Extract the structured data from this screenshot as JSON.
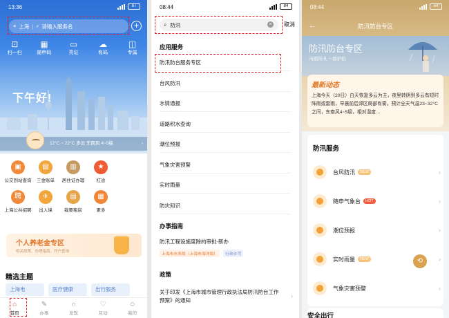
{
  "panel1": {
    "status": {
      "time": "13:36",
      "battery": "87"
    },
    "search": {
      "location": "上海",
      "placeholder": "请输入服务名"
    },
    "quick": [
      {
        "icon": "scan-icon",
        "glyph": "⊡",
        "label": "扫一扫"
      },
      {
        "icon": "qr-icon",
        "glyph": "▦",
        "label": "随申码"
      },
      {
        "icon": "card-icon",
        "glyph": "▭",
        "label": "亮证"
      },
      {
        "icon": "cloud-icon",
        "glyph": "☁",
        "label": "有码"
      },
      {
        "icon": "zone-icon",
        "glyph": "◫",
        "label": "专属"
      }
    ],
    "greeting": "下午好!",
    "weather": "12°C ~ 22°C  多云  东南风 4~5级",
    "services": [
      {
        "label": "公交到站查询",
        "color": "#f08a3a",
        "glyph": "▣"
      },
      {
        "label": "三金账单",
        "color": "#f3a63b",
        "glyph": "▤"
      },
      {
        "label": "居住证办理",
        "color": "#c79a62",
        "glyph": "▥"
      },
      {
        "label": "红途",
        "color": "#ee5b35",
        "glyph": "★"
      },
      {
        "label": "",
        "color": "",
        "glyph": ""
      },
      {
        "label": "上海公共招聘",
        "color": "#f08a3a",
        "glyph": "聘"
      },
      {
        "label": "出入境",
        "color": "#f3a63b",
        "glyph": "✈"
      },
      {
        "label": "我要租房",
        "color": "#e6a54a",
        "glyph": "▤"
      },
      {
        "label": "更多",
        "color": "#f0863a",
        "glyph": "▦"
      }
    ],
    "banner": {
      "title": "个人养老金专区",
      "subtitle": "相关政策、办理指南、开户查询"
    },
    "topics_title": "精选主题",
    "topics": [
      "上海电",
      "医疗健康",
      "出行服务"
    ],
    "tabs": [
      {
        "label": "首页",
        "icon": "home-icon",
        "glyph": "⌂",
        "active": true
      },
      {
        "label": "办事",
        "icon": "pen-icon",
        "glyph": "✎",
        "active": false
      },
      {
        "label": "发现",
        "icon": "discover-icon",
        "glyph": "∩",
        "active": false
      },
      {
        "label": "互动",
        "icon": "heart-icon",
        "glyph": "♡",
        "active": false
      },
      {
        "label": "我的",
        "icon": "user-icon",
        "glyph": "☺",
        "active": false
      }
    ]
  },
  "panel2": {
    "status": {
      "time": "08:44",
      "battery": "84"
    },
    "search": {
      "value": "防汛",
      "cancel": "取消"
    },
    "app_section": "应用服务",
    "app_items": [
      "防汛防台服务专区",
      "台风防汛",
      "水情通报",
      "道路积水查询",
      "潮位预报",
      "气象灾害预警",
      "实时雨量",
      "防灾知识"
    ],
    "guide_section": "办事指南",
    "guide": {
      "title": "防汛工程设施度除的审批-新办",
      "tag1": "上海市水务局（上海市海洋局）",
      "tag2": "行政许可"
    },
    "policy_section": "政策",
    "policy": "关于印发《上海市城市管理行政执法局防汛防台工作预案》的通知"
  },
  "panel3": {
    "status": {
      "time": "08:44",
      "battery": "84"
    },
    "title": "防汛防台专区",
    "hero_title": "防汛防台专区",
    "hero_sub": "汛期防汛 一路护航",
    "news_title_a": "最新",
    "news_title_b": "动态",
    "news_body": "上海今天（20日）白天恢复多云为主，夜里转阴到多云有短时阵雨或雷雨，早晨前后郊区局部有雾。预计全天气温23~32°C之间，东南风4~5级，相对湿度…",
    "services_title": "防汛服务",
    "services": [
      {
        "label": "台风防汛",
        "badge": "NEW",
        "badge_type": "new"
      },
      {
        "label": "随申气象台",
        "badge": "HOT",
        "badge_type": "hot"
      },
      {
        "label": "潮位预报",
        "badge": "",
        "badge_type": ""
      },
      {
        "label": "实时雨量",
        "badge": "NEW",
        "badge_type": "new"
      },
      {
        "label": "气象灾害预警",
        "badge": "",
        "badge_type": ""
      }
    ],
    "bottom_title": "安全出行"
  }
}
